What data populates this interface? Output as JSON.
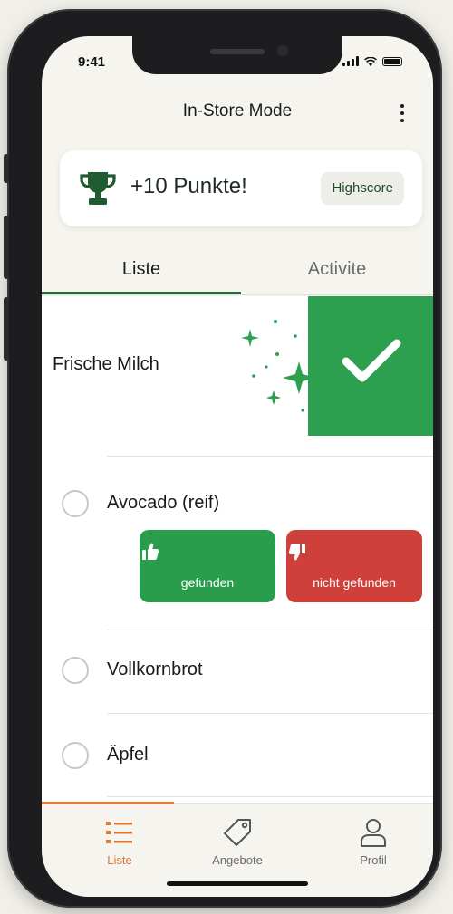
{
  "status": {
    "time": "9:41"
  },
  "header": {
    "title": "In-Store Mode"
  },
  "points": {
    "text": "+10 Punkte!",
    "highscore_label": "Highscore"
  },
  "tabs": [
    {
      "label": "Liste"
    },
    {
      "label": "Activite"
    }
  ],
  "list": {
    "items": [
      {
        "label": "Frische Milch",
        "state": "checked"
      },
      {
        "label": "Avocado (reif)",
        "state": "open"
      },
      {
        "label": "Vollkornbrot",
        "state": "open"
      },
      {
        "label": "Äpfel",
        "state": "open"
      }
    ],
    "actions": {
      "found_label": "gefunden",
      "not_found_label": "nicht gefunden"
    }
  },
  "bottom_nav": [
    {
      "label": "Liste",
      "icon": "list-icon",
      "active": true
    },
    {
      "label": "Angebote",
      "icon": "tag-icon"
    },
    {
      "label": "Profil",
      "icon": "user-icon"
    }
  ],
  "colors": {
    "primary_green": "#2ca04f",
    "danger_red": "#d0403a",
    "accent_orange": "#e8762d",
    "dark_green": "#1f4d2a"
  }
}
